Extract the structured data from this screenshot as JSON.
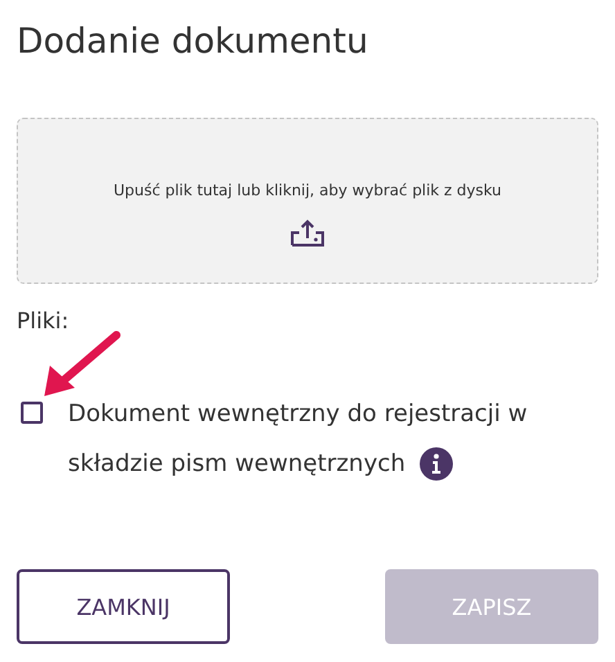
{
  "dialog": {
    "title": "Dodanie dokumentu"
  },
  "dropzone": {
    "text": "Upuść plik tutaj lub kliknij, aby wybrać plik z dysku"
  },
  "files": {
    "label": "Pliki:"
  },
  "checkbox": {
    "label_lines": [
      "Dokument wewnętrzny do rejestracji w",
      "składzie pism wewnętrznych"
    ],
    "checked": false
  },
  "buttons": [
    {
      "label": "ZAMKNIJ",
      "kind": "outline",
      "disabled": false
    },
    {
      "label": "ZAPISZ",
      "kind": "primary",
      "disabled": true
    }
  ]
}
